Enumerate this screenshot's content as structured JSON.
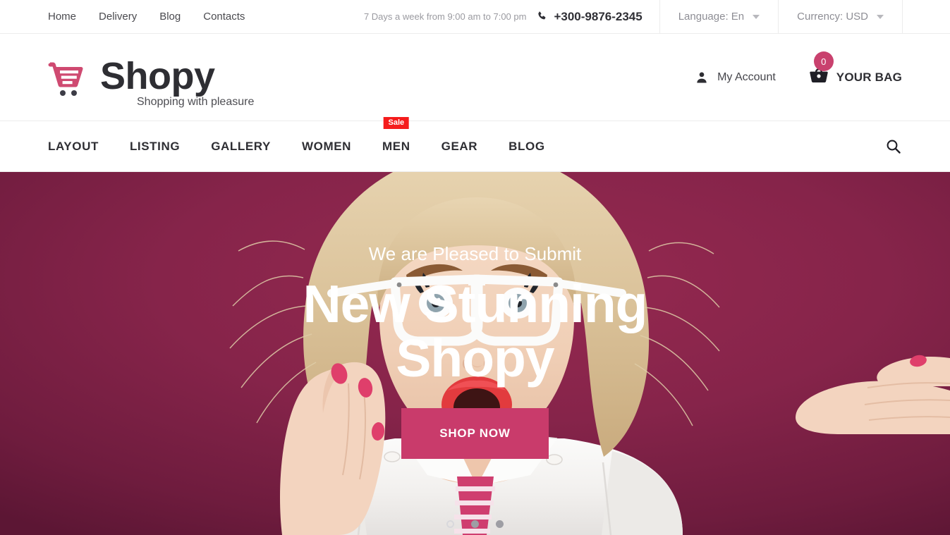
{
  "topbar": {
    "links": [
      {
        "label": "Home"
      },
      {
        "label": "Delivery"
      },
      {
        "label": "Blog"
      },
      {
        "label": "Contacts"
      }
    ],
    "hours": "7 Days a week from 9:00 am to 7:00 pm",
    "phone": "+300-9876-2345",
    "language": "Language: En",
    "currency": "Currency: USD"
  },
  "logobar": {
    "brand": "Shopy",
    "tagline": "Shopping with pleasure",
    "account_label": "My Account",
    "bag_label": "YOUR BAG",
    "bag_count": "0"
  },
  "mainnav": {
    "items": [
      {
        "label": "LAYOUT",
        "badge": ""
      },
      {
        "label": "LISTING",
        "badge": ""
      },
      {
        "label": "GALLERY",
        "badge": ""
      },
      {
        "label": "WOMEN",
        "badge": ""
      },
      {
        "label": "MEN",
        "badge": "Sale"
      },
      {
        "label": "GEAR",
        "badge": ""
      },
      {
        "label": "BLOG",
        "badge": ""
      }
    ]
  },
  "hero": {
    "subtitle": "We are Pleased to Submit",
    "title": "New Stunning Shopy",
    "cta": "SHOP NOW",
    "slides": 3,
    "active_slide": 1
  },
  "colors": {
    "brand_pink": "#c9416e",
    "cta_pink": "#c93b6b",
    "sale_red": "#f51c1c",
    "hero_bg": "#83234a",
    "text_dark": "#2e2e33",
    "text_muted": "#9a9aa0"
  }
}
